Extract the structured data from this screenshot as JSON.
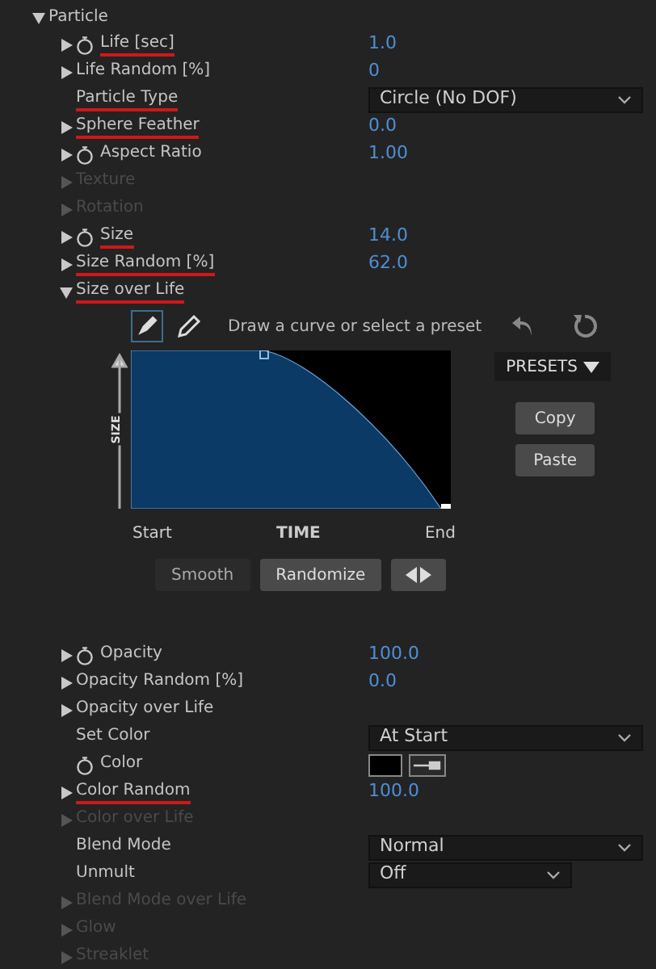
{
  "group": {
    "label": "Particle",
    "expanded": true
  },
  "rows_top": [
    {
      "label": "Life [sec]",
      "arrow": true,
      "expanded": false,
      "stopwatch": true,
      "kind": "number",
      "value": "1.0",
      "disabled": false,
      "marked": true
    },
    {
      "label": "Life Random [%]",
      "arrow": true,
      "expanded": false,
      "stopwatch": false,
      "kind": "number",
      "value": "0",
      "disabled": false,
      "marked": false
    },
    {
      "label": "Particle Type",
      "arrow": false,
      "stopwatch": false,
      "kind": "dropdown",
      "value": "Circle (No DOF)",
      "disabled": false,
      "marked": true
    },
    {
      "label": "Sphere Feather",
      "arrow": true,
      "expanded": false,
      "stopwatch": false,
      "kind": "number",
      "value": "0.0",
      "disabled": false,
      "marked": true
    },
    {
      "label": "Aspect Ratio",
      "arrow": true,
      "expanded": false,
      "stopwatch": true,
      "kind": "number",
      "value": "1.00",
      "disabled": false,
      "marked": false
    },
    {
      "label": "Texture",
      "arrow": true,
      "expanded": false,
      "stopwatch": false,
      "kind": "none",
      "disabled": true,
      "marked": false
    },
    {
      "label": "Rotation",
      "arrow": true,
      "expanded": false,
      "stopwatch": false,
      "kind": "none",
      "disabled": true,
      "marked": false
    },
    {
      "label": "Size",
      "arrow": true,
      "expanded": false,
      "stopwatch": true,
      "kind": "number",
      "value": "14.0",
      "disabled": false,
      "marked": true
    },
    {
      "label": "Size Random [%]",
      "arrow": true,
      "expanded": false,
      "stopwatch": false,
      "kind": "number",
      "value": "62.0",
      "disabled": false,
      "marked": true
    },
    {
      "label": "Size over Life",
      "arrow": true,
      "expanded": true,
      "stopwatch": false,
      "kind": "none",
      "disabled": false,
      "marked": true
    }
  ],
  "curve_editor": {
    "tools": [
      {
        "kind": "pen",
        "selected": true
      },
      {
        "kind": "pencil",
        "selected": false
      }
    ],
    "hint": "Draw a curve or select a preset",
    "presets": "PRESETS",
    "copy": "Copy",
    "paste": "Paste",
    "y_axis": "SIZE",
    "x_start": "Start",
    "x_label": "TIME",
    "x_end": "End",
    "buttons": [
      {
        "label": "Smooth",
        "selected": false
      },
      {
        "label": "Randomize",
        "selected": true
      }
    ]
  },
  "rows_bottom": [
    {
      "label": "Opacity",
      "arrow": true,
      "expanded": false,
      "stopwatch": true,
      "kind": "number",
      "value": "100.0",
      "disabled": false,
      "marked": false
    },
    {
      "label": "Opacity Random [%]",
      "arrow": true,
      "expanded": false,
      "stopwatch": false,
      "kind": "number",
      "value": "0.0",
      "disabled": false,
      "marked": false
    },
    {
      "label": "Opacity over Life",
      "arrow": true,
      "expanded": false,
      "stopwatch": false,
      "kind": "none",
      "disabled": false,
      "marked": false
    },
    {
      "label": "Set Color",
      "arrow": false,
      "stopwatch": false,
      "kind": "dropdown",
      "value": "At Start",
      "disabled": false,
      "marked": false
    },
    {
      "label": "Color",
      "arrow": false,
      "stopwatch": true,
      "kind": "color",
      "color": "#000000",
      "disabled": false,
      "marked": false
    },
    {
      "label": "Color Random",
      "arrow": true,
      "expanded": false,
      "stopwatch": false,
      "kind": "number",
      "value": "100.0",
      "disabled": false,
      "marked": true
    },
    {
      "label": "Color over Life",
      "arrow": true,
      "expanded": false,
      "stopwatch": false,
      "kind": "none",
      "disabled": true,
      "marked": false
    },
    {
      "label": "Blend Mode",
      "arrow": false,
      "stopwatch": false,
      "kind": "dropdown",
      "value": "Normal",
      "disabled": false,
      "marked": false
    },
    {
      "label": "Unmult",
      "arrow": false,
      "stopwatch": false,
      "kind": "short_dropdown",
      "value": "Off",
      "disabled": false,
      "marked": false
    },
    {
      "label": "Blend Mode over Life",
      "arrow": true,
      "expanded": false,
      "stopwatch": false,
      "kind": "none",
      "disabled": true,
      "marked": false
    },
    {
      "label": "Glow",
      "arrow": true,
      "expanded": false,
      "stopwatch": false,
      "kind": "none",
      "disabled": true,
      "marked": false
    },
    {
      "label": "Streaklet",
      "arrow": true,
      "expanded": false,
      "stopwatch": false,
      "kind": "none",
      "disabled": true,
      "marked": false
    }
  ]
}
